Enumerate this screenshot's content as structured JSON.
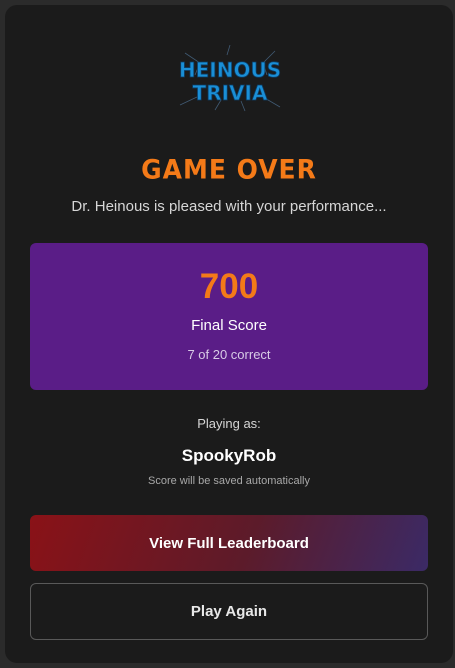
{
  "logo": {
    "line1": "HEINOUS",
    "line2": "TRIVIA"
  },
  "title": "GAME OVER",
  "subtitle": "Dr. Heinous is pleased with your performance...",
  "score": {
    "value": "700",
    "label": "Final Score",
    "correct": "7 of 20 correct"
  },
  "player": {
    "playing_as_label": "Playing as:",
    "username": "SpookyRob",
    "save_note": "Score will be saved automatically"
  },
  "buttons": {
    "leaderboard": "View Full Leaderboard",
    "play_again": "Play Again"
  },
  "colors": {
    "accent_orange": "#f47a18",
    "score_box": "#5a1d87",
    "card_bg": "#1b1b1b",
    "logo_blue": "#1a8fd6"
  }
}
